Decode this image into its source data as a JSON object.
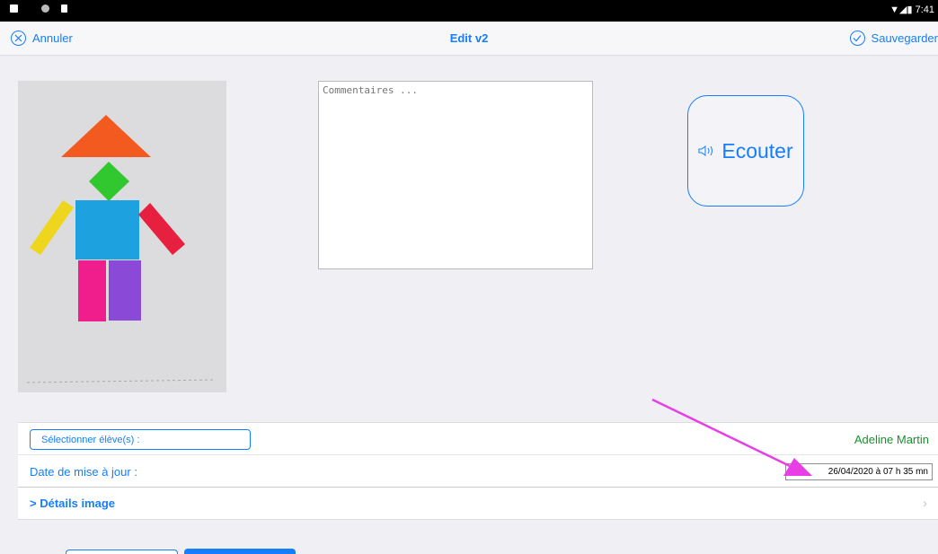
{
  "status_bar": {
    "time": "7:41"
  },
  "nav": {
    "cancel_label": "Annuler",
    "title": "Edit v2",
    "save_label": "Sauvegarder"
  },
  "comments": {
    "placeholder": "Commentaires ..."
  },
  "listen": {
    "label": "Ecouter"
  },
  "form": {
    "select_students_label": "Sélectionner élève(s) :",
    "student_name": "Adeline Martin",
    "date_label": "Date de mise à jour :",
    "date_value": "26/04/2020 à 07 h 35 mn",
    "details_label": "> Détails image",
    "details_chevron": "›"
  },
  "colors": {
    "accent": "#147efb",
    "student": "#1a8f2e",
    "annotation_arrow": "#e83ee6"
  }
}
